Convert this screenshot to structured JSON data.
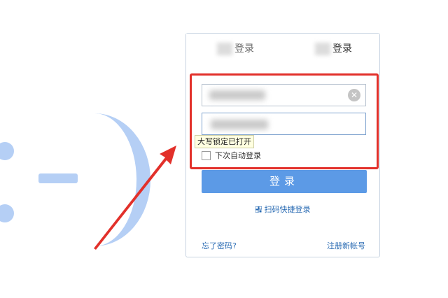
{
  "tabs": [
    {
      "label": "登录"
    },
    {
      "label": "登录"
    }
  ],
  "tooltip": {
    "text": "大写锁定已打开"
  },
  "remember": {
    "label": "下次自动登录"
  },
  "login_button": {
    "label": "登录"
  },
  "qr_login": {
    "label": "扫码快捷登录"
  },
  "footer": {
    "forgot_password": "忘了密码?",
    "register": "注册新帐号"
  },
  "colors": {
    "primary_button": "#5c9ae6",
    "link": "#2a6bb3",
    "highlight": "#e2302a",
    "smiley": "#b5cff5"
  },
  "icons": {
    "clear": "clear-icon",
    "qr": "qr-code-icon",
    "checkbox": "checkbox-unchecked"
  }
}
